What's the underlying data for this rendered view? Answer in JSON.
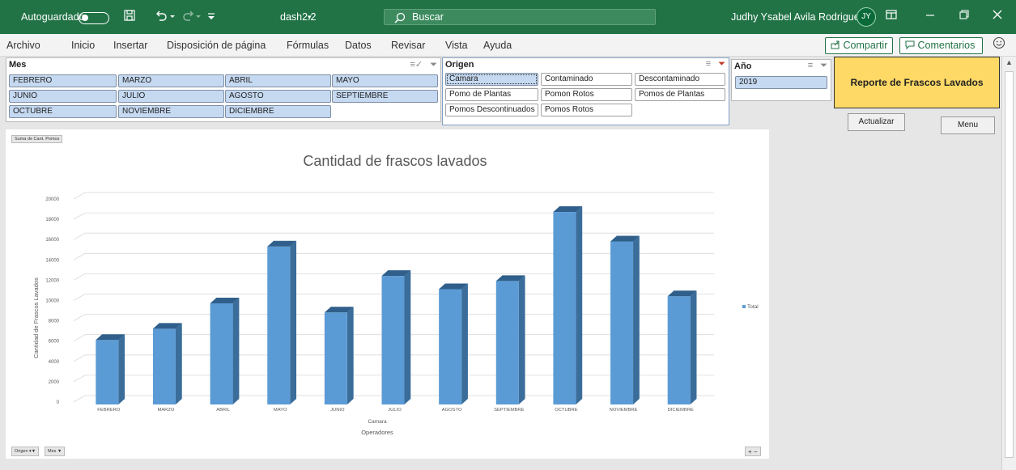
{
  "titlebar": {
    "autosave": "Autoguardado",
    "filename": "dash2.2",
    "search": "Buscar",
    "user": "Judhy Ysabel Avila Rodriguez",
    "initials": "JY"
  },
  "ribbon": {
    "tabs": [
      "Archivo",
      "Inicio",
      "Insertar",
      "Disposición de página",
      "Fórmulas",
      "Datos",
      "Revisar",
      "Vista",
      "Ayuda"
    ],
    "share": "Compartir",
    "comments": "Comentarios"
  },
  "slicers": {
    "mes": {
      "title": "Mes",
      "items": [
        "FEBRERO",
        "MARZO",
        "ABRIL",
        "MAYO",
        "JUNIO",
        "JULIO",
        "AGOSTO",
        "SEPTIEMBRE",
        "OCTUBRE",
        "NOVIEMBRE",
        "DICIEMBRE"
      ]
    },
    "origen": {
      "title": "Origen",
      "items": [
        "Camara",
        "Contaminado",
        "Descontaminado",
        "Pomo de Plantas",
        "Pomon Rotos",
        "Pomos de Plantas",
        "Pomos Descontinuados",
        "Pomos Rotos"
      ]
    },
    "anio": {
      "title": "Año",
      "items": [
        "2019"
      ]
    }
  },
  "report_title": "Reporte de Frascos Lavados",
  "buttons": {
    "actualizar": "Actualizar",
    "menu": "Menu"
  },
  "pivot": {
    "value_field": "Suma de Cant. Pomos",
    "filter_origen": "Origen",
    "filter_mes": "Mes"
  },
  "colors": {
    "excel_green": "#217346",
    "bar": "#5b9bd5",
    "bar_side": "#3a6d9a",
    "bar_top": "#2f5f8a",
    "report_fill": "#ffd966",
    "slicer_selected": "#c5d9f1"
  },
  "chart_data": {
    "type": "bar",
    "title": "Cantidad de frascos lavados",
    "xlabel": "Operadores",
    "x_group_label": "Camara",
    "ylabel": "Cantidad de Frascos Lavados",
    "ylim": [
      0,
      20000
    ],
    "yticks": [
      0,
      2000,
      4000,
      6000,
      8000,
      10000,
      12000,
      14000,
      16000,
      18000,
      20000
    ],
    "grid": true,
    "legend_position": "right",
    "categories": [
      "FEBRERO",
      "MARZO",
      "ABRIL",
      "MAYO",
      "JUNIO",
      "JULIO",
      "AGOSTO",
      "SEPTIEMBRE",
      "OCTUBRE",
      "NOVIEMBRE",
      "DICIEMBRE"
    ],
    "series": [
      {
        "name": "Total",
        "values": [
          6200,
          7300,
          9800,
          15400,
          8900,
          12500,
          11200,
          12000,
          18800,
          15900,
          10500
        ]
      }
    ]
  }
}
